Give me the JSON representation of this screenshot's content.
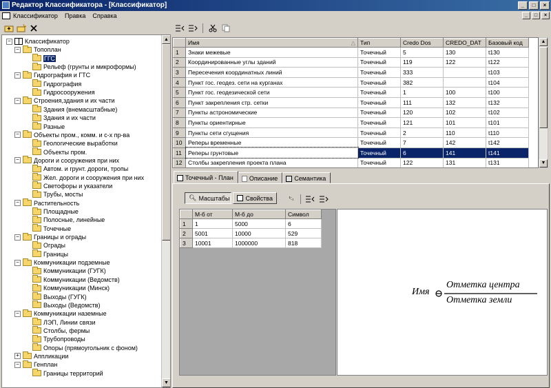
{
  "window": {
    "title": "Редактор Классификатора - [Классификатор]"
  },
  "menu": [
    "Классификатор",
    "Правка",
    "Справка"
  ],
  "tree": {
    "nodes": [
      {
        "label": "Классификатор",
        "level": 0,
        "type": "root",
        "expanded": true
      },
      {
        "label": "Топоплан",
        "level": 1,
        "type": "folder",
        "expanded": true
      },
      {
        "label": "ГГС",
        "level": 2,
        "type": "folder",
        "selected": true
      },
      {
        "label": "Рельеф (грунты и микроформы)",
        "level": 2,
        "type": "folder"
      },
      {
        "label": "Гидрография и ГТС",
        "level": 1,
        "type": "folder",
        "expanded": true
      },
      {
        "label": "Гидрография",
        "level": 2,
        "type": "folder"
      },
      {
        "label": "Гидросооружения",
        "level": 2,
        "type": "folder"
      },
      {
        "label": "Строения,здания и их части",
        "level": 1,
        "type": "folder",
        "expanded": true
      },
      {
        "label": "Здания (внемасштабные)",
        "level": 2,
        "type": "folder"
      },
      {
        "label": "Здания и их части",
        "level": 2,
        "type": "folder"
      },
      {
        "label": "Разные",
        "level": 2,
        "type": "folder"
      },
      {
        "label": "Объекты пром., комм. и с-х пр-ва",
        "level": 1,
        "type": "folder",
        "expanded": true
      },
      {
        "label": "Геологические выработки",
        "level": 2,
        "type": "folder"
      },
      {
        "label": "Объекты пром.",
        "level": 2,
        "type": "folder"
      },
      {
        "label": "Дороги и сооружения при них",
        "level": 1,
        "type": "folder",
        "expanded": true
      },
      {
        "label": "Автом. и грунт. дороги, тропы",
        "level": 2,
        "type": "folder"
      },
      {
        "label": "Жел. дороги и сооружения при них",
        "level": 2,
        "type": "folder"
      },
      {
        "label": "Светофоры и указатели",
        "level": 2,
        "type": "folder"
      },
      {
        "label": "Трубы, мосты",
        "level": 2,
        "type": "folder"
      },
      {
        "label": "Растительность",
        "level": 1,
        "type": "folder",
        "expanded": true
      },
      {
        "label": "Площадные",
        "level": 2,
        "type": "folder"
      },
      {
        "label": "Полосные, линейные",
        "level": 2,
        "type": "folder"
      },
      {
        "label": "Точечные",
        "level": 2,
        "type": "folder"
      },
      {
        "label": "Границы и ограды",
        "level": 1,
        "type": "folder",
        "expanded": true
      },
      {
        "label": "Ограды",
        "level": 2,
        "type": "folder"
      },
      {
        "label": "Границы",
        "level": 2,
        "type": "folder"
      },
      {
        "label": "Коммуникации подземные",
        "level": 1,
        "type": "folder",
        "expanded": true
      },
      {
        "label": "Коммуникации (ГУГК)",
        "level": 2,
        "type": "folder"
      },
      {
        "label": "Коммуникации (Ведомств)",
        "level": 2,
        "type": "folder"
      },
      {
        "label": "Коммуникации (Минск)",
        "level": 2,
        "type": "folder"
      },
      {
        "label": "Выходы (ГУГК)",
        "level": 2,
        "type": "folder"
      },
      {
        "label": "Выходы (Ведомств)",
        "level": 2,
        "type": "folder"
      },
      {
        "label": "Коммуникации наземные",
        "level": 1,
        "type": "folder",
        "expanded": true
      },
      {
        "label": "ЛЭП, Линии связи",
        "level": 2,
        "type": "folder"
      },
      {
        "label": "Столбы, фермы",
        "level": 2,
        "type": "folder"
      },
      {
        "label": "Трубопроводы",
        "level": 2,
        "type": "folder"
      },
      {
        "label": "Опоры (прямоугольник с фоном)",
        "level": 2,
        "type": "folder"
      },
      {
        "label": "Аппликации",
        "level": 1,
        "type": "folder"
      },
      {
        "label": "Генплан",
        "level": 1,
        "type": "folder",
        "expanded": true
      },
      {
        "label": "Границы территорий",
        "level": 2,
        "type": "folder"
      }
    ]
  },
  "grid": {
    "columns": [
      "Имя",
      "Тип",
      "Credo Dos",
      "CREDO_DAT",
      "Базовый код"
    ],
    "rows": [
      [
        "1",
        "Знаки межевые",
        "Точечный",
        "5",
        "130",
        "t130"
      ],
      [
        "2",
        "Координированные углы зданий",
        "Точечный",
        "119",
        "122",
        "t122"
      ],
      [
        "3",
        "Пересечения координатных линий",
        "Точечный",
        "333",
        "",
        "t103"
      ],
      [
        "4",
        "Пункт гос. геодез. сети на курганах",
        "Точечный",
        "382",
        "",
        "t104"
      ],
      [
        "5",
        "Пункт гос. геодезической сети",
        "Точечный",
        "1",
        "100",
        "t100"
      ],
      [
        "6",
        "Пункт закрепления стр. сетки",
        "Точечный",
        "111",
        "132",
        "t132"
      ],
      [
        "7",
        "Пункты астрономические",
        "Точечный",
        "120",
        "102",
        "t102"
      ],
      [
        "8",
        "Пункты ориентирные",
        "Точечный",
        "121",
        "101",
        "t101"
      ],
      [
        "9",
        "Пункты сети сгущения",
        "Точечный",
        "2",
        "110",
        "t110"
      ],
      [
        "10",
        "Реперы временные",
        "Точечный",
        "7",
        "142",
        "t142"
      ],
      [
        "11",
        "Реперы грунтовые",
        "Точечный",
        "6",
        "141",
        "t141"
      ],
      [
        "12",
        "Столбы закрепления проекта плана",
        "Точечный",
        "122",
        "131",
        "t131"
      ]
    ],
    "selected_row": 11
  },
  "tabs": [
    {
      "label": "Точечный - План",
      "active": true
    },
    {
      "label": "Описание",
      "active": false
    },
    {
      "label": "Семантика",
      "active": false
    }
  ],
  "panel": {
    "scale_button": "Масштабы",
    "props_button": "Свойства",
    "scale_columns": [
      "М-б от",
      "М-б до",
      "Символ"
    ],
    "scale_rows": [
      [
        "1",
        "1",
        "5000",
        "6"
      ],
      [
        "2",
        "5001",
        "10000",
        "529"
      ],
      [
        "3",
        "10001",
        "1000000",
        "818"
      ]
    ],
    "preview": {
      "name": "Имя",
      "top_label": "Отметка центра",
      "bottom_label": "Отметка земли"
    }
  }
}
